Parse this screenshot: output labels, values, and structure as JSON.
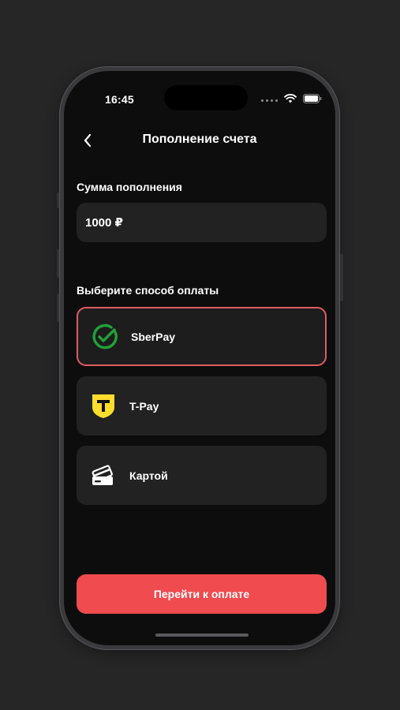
{
  "status_bar": {
    "time": "16:45"
  },
  "header": {
    "title": "Пополнение счета"
  },
  "amount": {
    "label": "Сумма пополнения",
    "value": "1000 ₽"
  },
  "payment": {
    "label": "Выберите способ оплаты",
    "options": [
      {
        "label": "SberPay",
        "icon": "sberpay-icon",
        "selected": true
      },
      {
        "label": "T-Pay",
        "icon": "tpay-icon",
        "selected": false
      },
      {
        "label": "Картой",
        "icon": "card-icon",
        "selected": false
      }
    ]
  },
  "cta": {
    "label": "Перейти к оплате"
  },
  "colors": {
    "accent": "#f04c50",
    "selected_border": "#e05c63",
    "sber_green": "#21a038",
    "tpay_yellow": "#ffdd2d"
  }
}
